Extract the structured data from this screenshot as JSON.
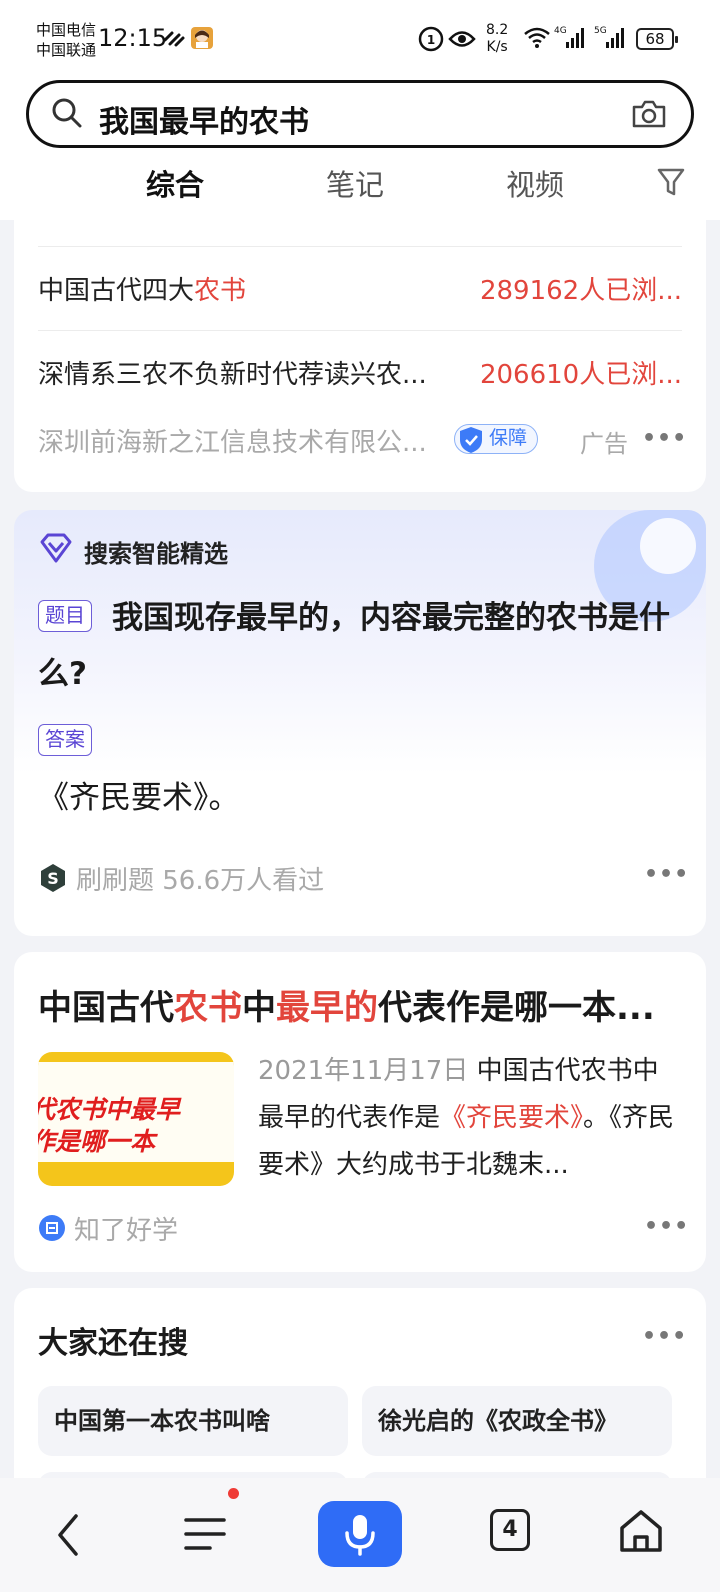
{
  "status_bar": {
    "carrier1": "中国电信",
    "carrier2": "中国联通",
    "time": "12:15",
    "speed_value": "8.2",
    "speed_unit": "K/s",
    "net1": "4G",
    "net2": "5G",
    "battery": "68"
  },
  "search": {
    "query": "我国最早的农书"
  },
  "tabs": [
    {
      "label": "综合",
      "active": true
    },
    {
      "label": "笔记",
      "active": false
    },
    {
      "label": "视频",
      "active": false
    }
  ],
  "ad_card": {
    "rows": [
      {
        "left_plain": "中国古代四大",
        "left_hl": "农书",
        "right": "289162人已浏..."
      },
      {
        "left_plain": "深情系三农不负新时代荐读兴农...",
        "left_hl": "",
        "right": "206610人已浏..."
      }
    ],
    "company": "深圳前海新之江信息技术有限公...",
    "badge": "保障",
    "ad_label": "广告",
    "more": "•••"
  },
  "ai_card": {
    "header": "搜索智能精选",
    "question_tag": "题目",
    "question": "我国现存最早的，内容最完整的农书是什么?",
    "answer_tag": "答案",
    "answer": "《齐民要术》。",
    "source": "刷刷题 56.6万人看过",
    "more": "•••"
  },
  "news_card": {
    "title_parts": [
      "中国古代",
      "农书",
      "中",
      "最早的",
      "代表作是哪一本..."
    ],
    "thumb_line1": "代农书中最早",
    "thumb_line2": "作是哪一本",
    "date": "2021年11月17日",
    "body_part1": "中国古代农书中最早的代表作是",
    "body_hl": "《齐民要术》",
    "body_part2": "。《齐民要术》大约成书于北魏末...",
    "source": "知了好学",
    "more": "•••"
  },
  "related": {
    "title": "大家还在搜",
    "more": "•••",
    "items": [
      "中国第一本农书叫啥",
      "徐光启的《农政全书》"
    ]
  },
  "bottom_nav": {
    "tab_count": "4"
  },
  "colors": {
    "accent": "#2f6cf6",
    "highlight": "#e2453c",
    "tag": "#5a45d4"
  }
}
